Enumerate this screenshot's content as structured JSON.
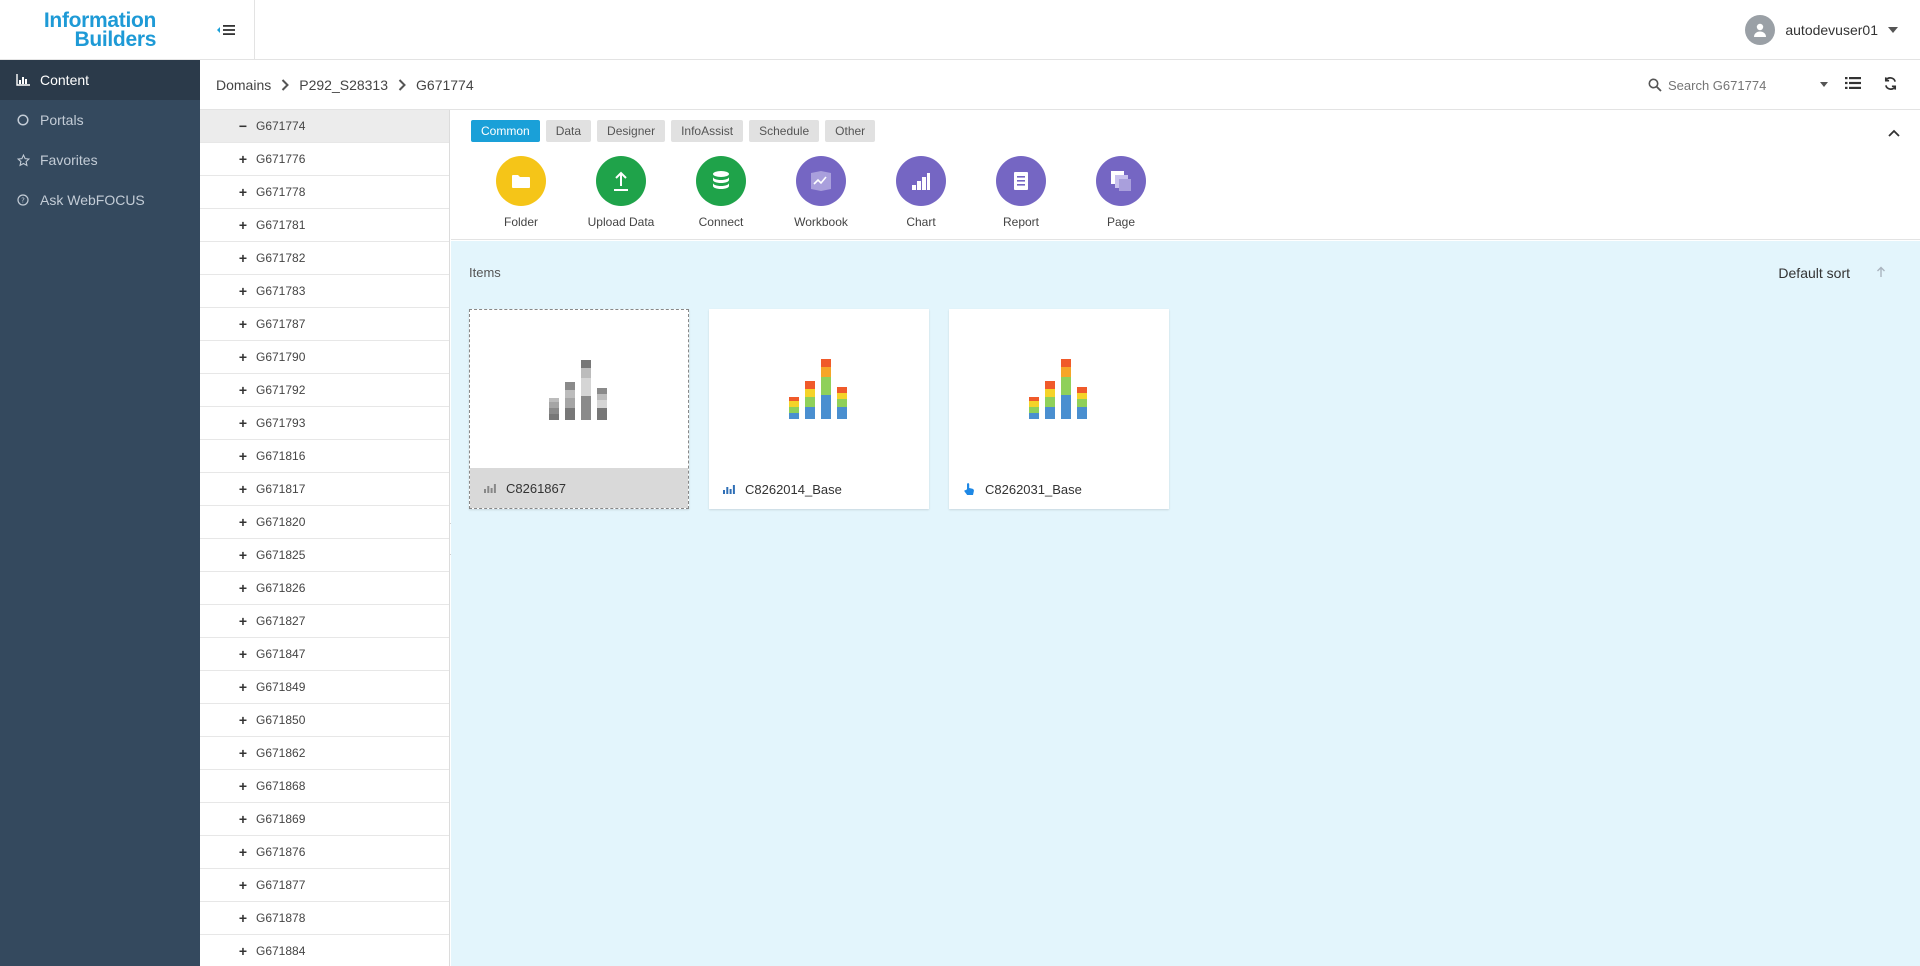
{
  "brand": {
    "logo_line1": "Information",
    "logo_line2": "Builders"
  },
  "nav": [
    {
      "label": "Content",
      "icon": "bar-chart-icon",
      "active": true
    },
    {
      "label": "Portals",
      "icon": "circle-icon"
    },
    {
      "label": "Favorites",
      "icon": "star-icon"
    },
    {
      "label": "Ask WebFOCUS",
      "icon": "help-circle-icon"
    }
  ],
  "user": {
    "name": "autodevuser01"
  },
  "breadcrumb": [
    "Domains",
    "P292_S28313",
    "G671774"
  ],
  "search": {
    "placeholder": "Search G671774"
  },
  "tree": [
    {
      "label": "G671774",
      "toggle": "−",
      "selected": true
    },
    {
      "label": "G671776",
      "toggle": "+"
    },
    {
      "label": "G671778",
      "toggle": "+"
    },
    {
      "label": "G671781",
      "toggle": "+"
    },
    {
      "label": "G671782",
      "toggle": "+"
    },
    {
      "label": "G671783",
      "toggle": "+"
    },
    {
      "label": "G671787",
      "toggle": "+"
    },
    {
      "label": "G671790",
      "toggle": "+"
    },
    {
      "label": "G671792",
      "toggle": "+"
    },
    {
      "label": "G671793",
      "toggle": "+"
    },
    {
      "label": "G671816",
      "toggle": "+"
    },
    {
      "label": "G671817",
      "toggle": "+"
    },
    {
      "label": "G671820",
      "toggle": "+"
    },
    {
      "label": "G671825",
      "toggle": "+"
    },
    {
      "label": "G671826",
      "toggle": "+"
    },
    {
      "label": "G671827",
      "toggle": "+"
    },
    {
      "label": "G671847",
      "toggle": "+"
    },
    {
      "label": "G671849",
      "toggle": "+"
    },
    {
      "label": "G671850",
      "toggle": "+"
    },
    {
      "label": "G671862",
      "toggle": "+"
    },
    {
      "label": "G671868",
      "toggle": "+"
    },
    {
      "label": "G671869",
      "toggle": "+"
    },
    {
      "label": "G671876",
      "toggle": "+"
    },
    {
      "label": "G671877",
      "toggle": "+"
    },
    {
      "label": "G671878",
      "toggle": "+"
    },
    {
      "label": "G671884",
      "toggle": "+"
    }
  ],
  "tabs": [
    {
      "label": "Common",
      "active": true
    },
    {
      "label": "Data"
    },
    {
      "label": "Designer"
    },
    {
      "label": "InfoAssist"
    },
    {
      "label": "Schedule"
    },
    {
      "label": "Other"
    }
  ],
  "tools": [
    {
      "label": "Folder",
      "icon": "folder-icon",
      "color": "#f5c518"
    },
    {
      "label": "Upload Data",
      "icon": "upload-icon",
      "color": "#1fa34a"
    },
    {
      "label": "Connect",
      "icon": "database-icon",
      "color": "#1fa34a"
    },
    {
      "label": "Workbook",
      "icon": "workbook-icon",
      "color": "#7566c3"
    },
    {
      "label": "Chart",
      "icon": "chart-icon",
      "color": "#7566c3"
    },
    {
      "label": "Report",
      "icon": "report-icon",
      "color": "#7566c3"
    },
    {
      "label": "Page",
      "icon": "page-icon",
      "color": "#7566c3"
    }
  ],
  "content": {
    "items_label": "Items",
    "sort_label": "Default sort",
    "cards": [
      {
        "name": "C8261867",
        "thumb": "grey-chart-thumbnail",
        "footer_icon": "chart-small-icon",
        "selected": true
      },
      {
        "name": "C8262014_Base",
        "thumb": "color-chart-thumbnail",
        "footer_icon": "chart-small-icon"
      },
      {
        "name": "C8262031_Base",
        "thumb": "color-chart-thumbnail",
        "footer_icon": "touch-icon"
      }
    ]
  },
  "colors": {
    "nav_bg": "#34495e",
    "accent": "#1aa0d8",
    "content_bg": "#e3f5fc"
  }
}
